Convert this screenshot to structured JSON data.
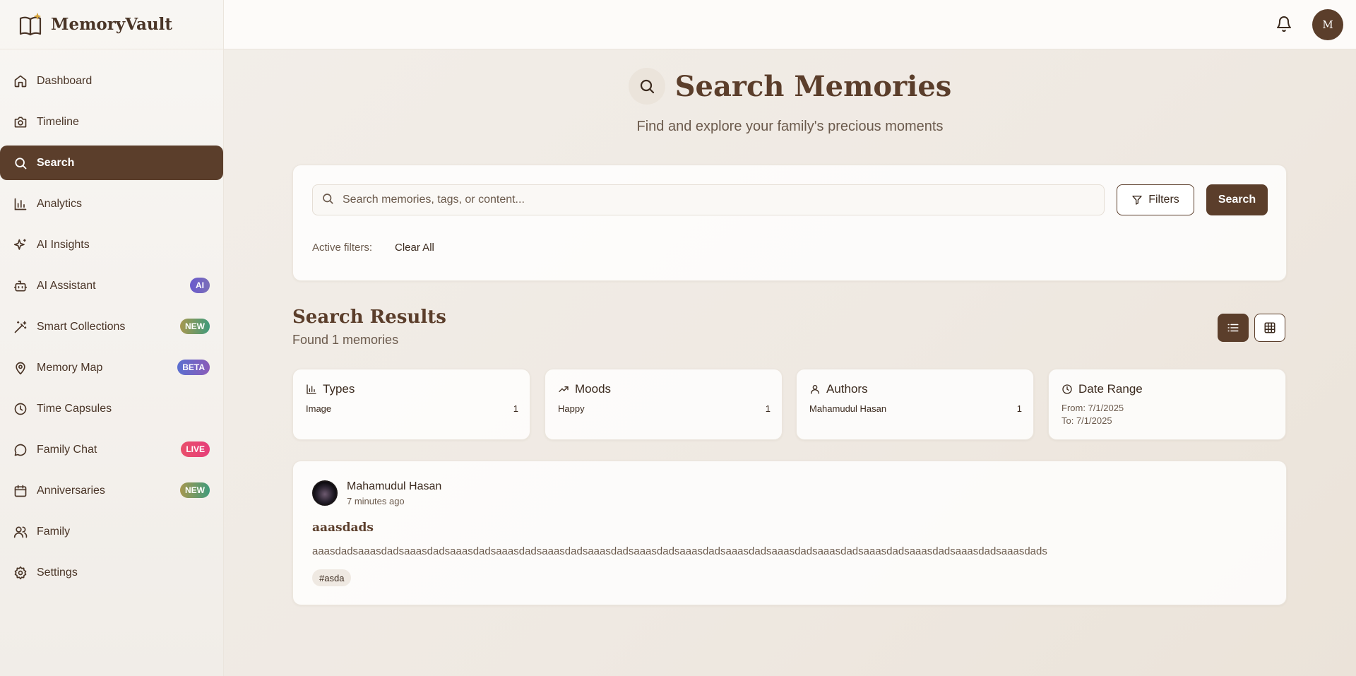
{
  "app": {
    "name": "MemoryVault",
    "avatar_initial": "M"
  },
  "sidebar": {
    "items": [
      {
        "label": "Dashboard",
        "icon": "home-icon"
      },
      {
        "label": "Timeline",
        "icon": "camera-icon"
      },
      {
        "label": "Search",
        "icon": "search-icon",
        "active": true
      },
      {
        "label": "Analytics",
        "icon": "bar-chart-icon"
      },
      {
        "label": "AI Insights",
        "icon": "sparkles-icon"
      },
      {
        "label": "AI Assistant",
        "icon": "bot-icon",
        "badge": "AI"
      },
      {
        "label": "Smart Collections",
        "icon": "wand-icon",
        "badge": "NEW"
      },
      {
        "label": "Memory Map",
        "icon": "map-pin-icon",
        "badge": "BETA"
      },
      {
        "label": "Time Capsules",
        "icon": "clock-icon"
      },
      {
        "label": "Family Chat",
        "icon": "chat-icon",
        "badge": "LIVE"
      },
      {
        "label": "Anniversaries",
        "icon": "calendar-icon",
        "badge": "NEW"
      },
      {
        "label": "Family",
        "icon": "users-icon"
      },
      {
        "label": "Settings",
        "icon": "gear-icon"
      }
    ]
  },
  "header": {
    "title": "Search Memories",
    "subtitle": "Find and explore your family's precious moments"
  },
  "search": {
    "placeholder": "Search memories, tags, or content...",
    "value": "",
    "filters_label": "Filters",
    "search_label": "Search",
    "active_filters_label": "Active filters:",
    "clear_all_label": "Clear All"
  },
  "results": {
    "title": "Search Results",
    "count_text": "Found 1 memories"
  },
  "stats": {
    "types": {
      "title": "Types",
      "item": "Image",
      "count": "1"
    },
    "moods": {
      "title": "Moods",
      "item": "Happy",
      "count": "1"
    },
    "authors": {
      "title": "Authors",
      "item": "Mahamudul Hasan",
      "count": "1"
    },
    "date_range": {
      "title": "Date Range",
      "from": "From: 7/1/2025",
      "to": "To: 7/1/2025"
    }
  },
  "memory": {
    "author": "Mahamudul Hasan",
    "time": "7 minutes ago",
    "title": "aaasdads",
    "content": "aaasdadsaaasdadsaaasdadsaaasdadsaaasdadsaaasdadsaaasdadsaaasdadsaaasdadsaaasdadsaaasdadsaaasdadsaaasdadsaaasdadsaaasdadsaaasdads",
    "tag": "#asda"
  },
  "colors": {
    "brand": "#5b3e2b",
    "badge_live": "#e94f6b",
    "badge_new": "#3f9a7b",
    "badge_ai": "#6a5acd"
  }
}
